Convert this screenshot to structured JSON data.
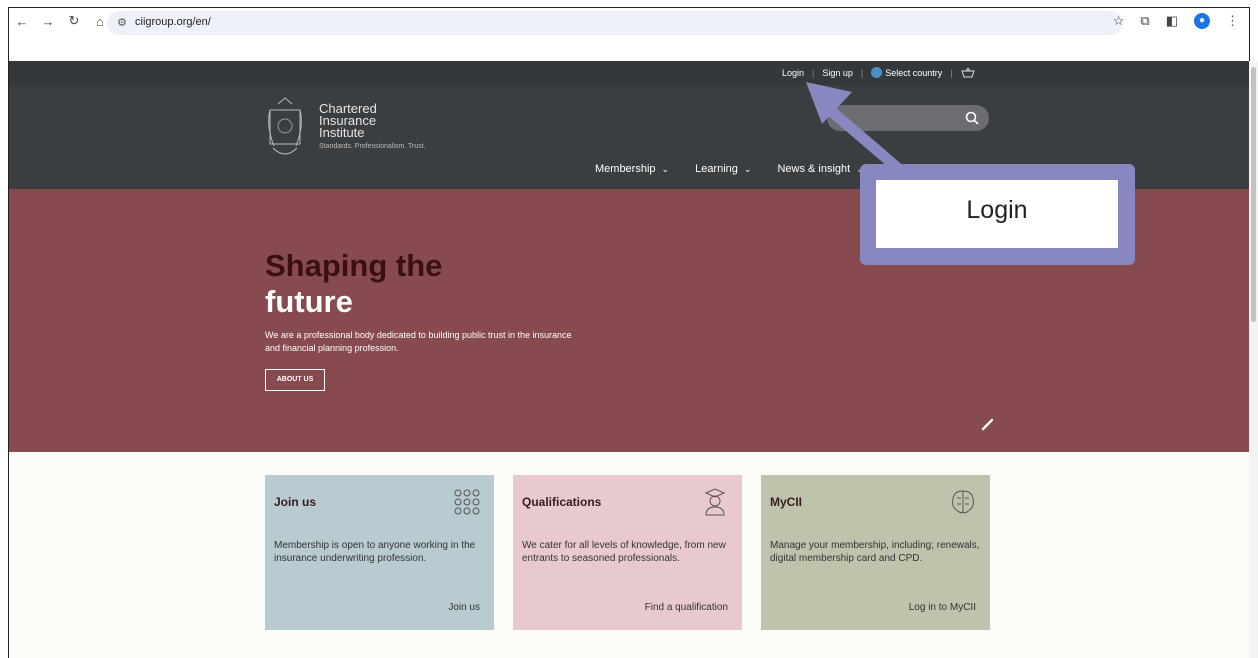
{
  "browser": {
    "url": "ciigroup.org/en/",
    "icons": [
      "back-icon",
      "forward-icon",
      "reload-icon",
      "home-icon",
      "star-icon",
      "extensions-icon",
      "sidepanel-icon",
      "profile-icon",
      "menu-icon"
    ]
  },
  "topbar": {
    "login": "Login",
    "signup": "Sign up",
    "select_country": "Select country"
  },
  "brand": {
    "line1": "Chartered",
    "line2": "Insurance",
    "line3": "Institute",
    "tagline": "Standards. Professionalism. Trust."
  },
  "nav": {
    "items": [
      {
        "label": "Membership"
      },
      {
        "label": "Learning"
      },
      {
        "label": "News & insight"
      }
    ]
  },
  "hero": {
    "title_line1": "Shaping the",
    "title_line2": "future",
    "text": "We are a professional body dedicated to building public trust in the insurance and financial planning profession.",
    "button": "ABOUT US"
  },
  "cards": [
    {
      "title": "Join us",
      "desc": "Membership is open to anyone working in the insurance underwriting profession.",
      "cta": "Join us"
    },
    {
      "title": "Qualifications",
      "desc": "We cater for all levels of knowledge, from new entrants to seasoned professionals.",
      "cta": "Find a qualification"
    },
    {
      "title": "MyCII",
      "desc": "Manage your membership, including; renewals, digital membership card and CPD.",
      "cta": "Log in to MyCII"
    }
  ],
  "callout": {
    "label": "Login"
  },
  "colors": {
    "header": "#3b3e41",
    "hero": "#864a4f",
    "callout": "#8987bf",
    "join_card": "#b7cbd0",
    "qual_card": "#e8c9ce",
    "mycii_card": "#bec3ac"
  }
}
